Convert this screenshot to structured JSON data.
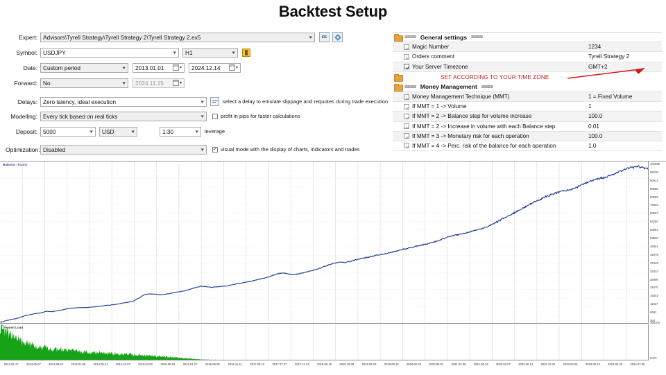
{
  "title": "Backtest Setup",
  "form": {
    "expert": {
      "label": "Expert:",
      "value": "Advisors\\Tyrell Strategy\\Tyrell Strategy 2\\Tyrell Strategy 2.ex5",
      "ide_button": "IDE",
      "gear_icon": "gear-icon"
    },
    "symbol": {
      "label": "Symbol:",
      "value": "USDJPY",
      "timeframe": "H1",
      "gold_icon": "symbol-properties-icon"
    },
    "date": {
      "label": "Date:",
      "period": "Custom period",
      "from": "2013.01.01",
      "to": "2024.12.14"
    },
    "forward": {
      "label": "Forward:",
      "value": "No",
      "date": "2024.11.15"
    },
    "delays": {
      "label": "Delays:",
      "value": "Zero latency, ideal execution",
      "hint": "select a delay to emulate slippage and requotes during trade execution",
      "icon": "delay-settings-icon"
    },
    "modelling": {
      "label": "Modelling:",
      "value": "Every tick based on real ticks",
      "checkbox_label": "profit in pips for faster calculations",
      "checkbox_checked": false
    },
    "deposit": {
      "label": "Deposit:",
      "amount": "5000",
      "currency": "USD",
      "leverage_value": "1:30",
      "leverage_label": "leverage"
    },
    "optimization": {
      "label": "Optimization:",
      "value": "Disabled",
      "checkbox_label": "visual mode with the display of charts, indicators and trades",
      "checkbox_checked": true
    }
  },
  "settings": {
    "general_header": "General settings",
    "money_header": "Money Management",
    "dashes": "====",
    "annotation": "SET ACCORDING TO YOUR TIME ZONE",
    "annotation_color": "#d11a1a",
    "general_rows": [
      {
        "name": "Magic Number",
        "value": "1234"
      },
      {
        "name": "Orders comment",
        "value": "Tyrell Strategy 2"
      },
      {
        "name": "Your Server Timezone",
        "value": "GMT+2"
      }
    ],
    "money_rows": [
      {
        "name": "Money Management Technique (MMT)",
        "value": "1 = Fixed Volume"
      },
      {
        "name": "If MMT = 1 -> Volume",
        "value": "1"
      },
      {
        "name": "If MMT = 2 -> Balance step for volume increase",
        "value": "100.0"
      },
      {
        "name": "If MMT = 2 -> Increase in volume with each Balance step",
        "value": "0.01"
      },
      {
        "name": "If MMT = 3 -> Monetary risk for each operation",
        "value": "100.0"
      },
      {
        "name": "If MMT = 4 -> Perc. risk of the balance for each operation",
        "value": "1.0"
      }
    ]
  },
  "chart_data": {
    "type": "line",
    "title": "Balance / Equity",
    "legend": {
      "balance": "Balance",
      "separator": "/",
      "equity": "Equity",
      "deposit_load": "Deposit Load"
    },
    "legend_position": "top-left",
    "grid": true,
    "xlabel": "",
    "ylabel": "",
    "ylim": [
      364,
      101565
    ],
    "y_ticks": [
      101565,
      96238,
      90912,
      85586,
      80259,
      74933,
      69607,
      64280,
      58954,
      53628,
      48301,
      42975,
      37649,
      32322,
      26996,
      21670,
      16343,
      11017,
      5691,
      364
    ],
    "y_bottom_label": "100.0%",
    "load_bottom_label": "0.0%",
    "x_ticks": [
      "2013.01.17",
      "2013.05.07",
      "2013.08.22",
      "2014.01.08",
      "2014.05.21",
      "2014.10.07",
      "2015.04.02",
      "2015.08.18",
      "2016.01.27",
      "2016.06.08",
      "2016.11.11",
      "2017.03.13",
      "2017.07.27",
      "2017.11.24",
      "2018.05.15",
      "2018.10.09",
      "2019.03.19",
      "2019.08.19",
      "2020.02.03",
      "2020.09.01",
      "2021.02.08",
      "2021.06.16",
      "2022.02.07",
      "2022.06.14",
      "2022.10.31",
      "2023.04.04",
      "2023.09.13",
      "2024.02.20",
      "2024.07.09"
    ],
    "series": [
      {
        "name": "Balance",
        "color": "#1f3a93",
        "values": [
          500,
          1200,
          2100,
          2600,
          3600,
          4700,
          5300,
          6000,
          6300,
          7400,
          7100,
          7600,
          8200,
          8900,
          9400,
          9600,
          9700,
          9800,
          10100,
          10400,
          10800,
          11200,
          11500,
          12000,
          12600,
          13200,
          13900,
          15800,
          17900,
          18400,
          18200,
          17800,
          18100,
          18600,
          19300,
          19900,
          20400,
          21400,
          22400,
          23200,
          23000,
          22500,
          22800,
          23100,
          23400,
          24100,
          24800,
          25400,
          25900,
          26600,
          27400,
          28100,
          28900,
          30100,
          31200,
          31600,
          31000,
          30600,
          31100,
          31800,
          32600,
          33400,
          34400,
          35600,
          36900,
          37900,
          38400,
          38300,
          38900,
          39900,
          40700,
          41300,
          42000,
          42800,
          43400,
          43900,
          44700,
          45600,
          46300,
          47100,
          47900,
          48600,
          49300,
          50200,
          51100,
          52000,
          53100,
          54400,
          55300,
          55900,
          56600,
          57400,
          58300,
          59200,
          60100,
          61400,
          63000,
          64800,
          66600,
          68200,
          69900,
          71600,
          73400,
          75200,
          76900,
          78400,
          79800,
          81100,
          82300,
          83200,
          83900,
          84600,
          85900,
          87600,
          89000,
          90300,
          91100,
          91800,
          92600,
          93900,
          95600,
          96900,
          97900,
          98600,
          99100,
          98400,
          97700
        ]
      },
      {
        "name": "Deposit Load",
        "color": "#17a317",
        "type": "area",
        "values": [
          100,
          88,
          74,
          63,
          55,
          50,
          44,
          40,
          38,
          34,
          32,
          30,
          29,
          28,
          26,
          25,
          24,
          23,
          22,
          21,
          20,
          20,
          19,
          18,
          18,
          17,
          16,
          15,
          14,
          13,
          12,
          11,
          10,
          9,
          8,
          7,
          6,
          5,
          4,
          3,
          2.5,
          2,
          1.8,
          1.5,
          1.2,
          1,
          0.9,
          0.8,
          0.7,
          0.6,
          0.5,
          0.5,
          0.4,
          0.4,
          0.3,
          0.3,
          0.3,
          0.2,
          0.2,
          0.2,
          0.2,
          0.2,
          0.2,
          0.2,
          0.1,
          0.1,
          0.1,
          0.1,
          0.1,
          0.1,
          0.1,
          0.1,
          0.1,
          0.1,
          0.1,
          0.1,
          0.1,
          0.1,
          0.1,
          0.1,
          0.1,
          0.1,
          0.1,
          0.1,
          0.1,
          0.1,
          0.1,
          0.1,
          0.1,
          0.1,
          0.1,
          0.1,
          0.1,
          0.1,
          0.1,
          0.1,
          0.1,
          0.1,
          0.1,
          0.1,
          0.1,
          0.1,
          0.1,
          0.1,
          0.1,
          0.1,
          0.1,
          0.1,
          0.1,
          0.1,
          0.1,
          0.1,
          0.1,
          0.1,
          0.1,
          0.1,
          0.1,
          0.1,
          0.1,
          0.1,
          0.1,
          0.1,
          0.1,
          0.1,
          0.1,
          0.1,
          0.1
        ]
      }
    ]
  }
}
